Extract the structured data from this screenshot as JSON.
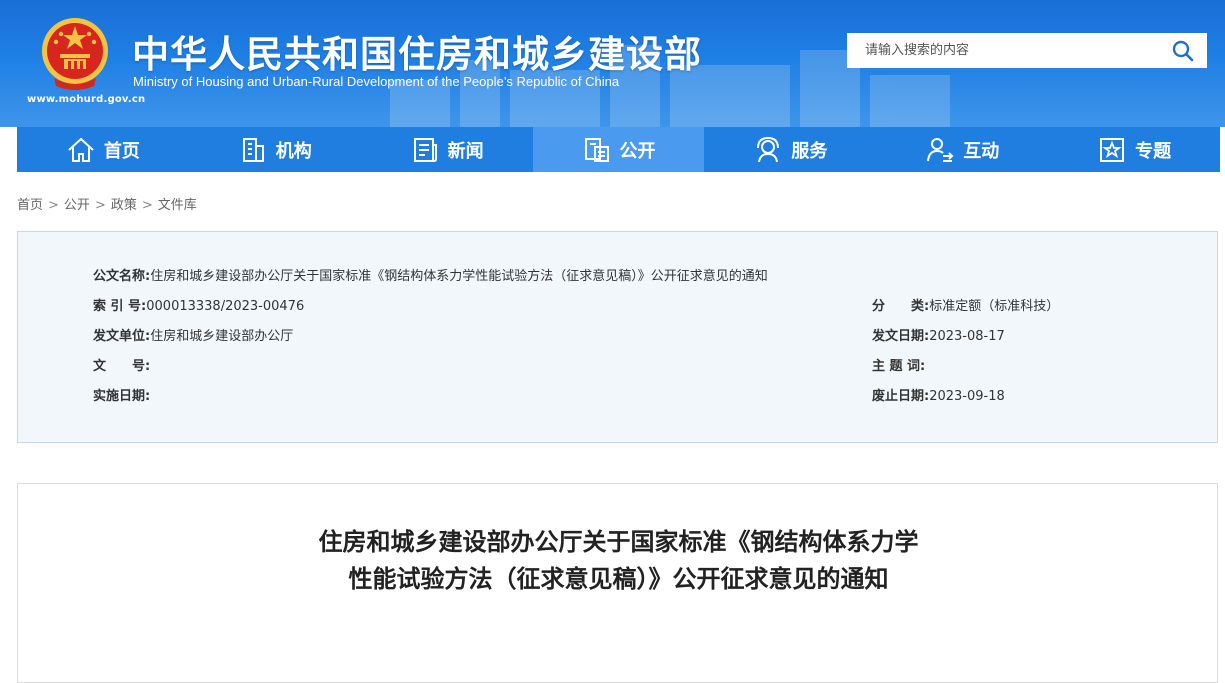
{
  "header": {
    "title": "中华人民共和国住房和城乡建设部",
    "subtitle": "Ministry of Housing and Urban-Rural Development of the People’s Republic of China",
    "url": "www.mohurd.gov.cn",
    "search_placeholder": "请输入搜索的内容",
    "colors": {
      "header_blue": "#1e7fe4",
      "nav_blue": "#1f7ee0",
      "nav_active": "#4a9bf0",
      "emblem_red": "#d7261e",
      "emblem_gold": "#f3c443"
    }
  },
  "nav": {
    "items": [
      {
        "label": "首页",
        "icon": "home-icon"
      },
      {
        "label": "机构",
        "icon": "building-icon"
      },
      {
        "label": "新闻",
        "icon": "news-icon"
      },
      {
        "label": "公开",
        "icon": "document-icon",
        "active": true
      },
      {
        "label": "服务",
        "icon": "service-icon"
      },
      {
        "label": "互动",
        "icon": "interaction-icon"
      },
      {
        "label": "专题",
        "icon": "star-icon"
      }
    ]
  },
  "breadcrumb": {
    "items": [
      "首页",
      "公开",
      "政策",
      "文件库"
    ],
    "separator": ">"
  },
  "info": {
    "doc_name_label": "公文名称:",
    "doc_name": "住房和城乡建设部办公厅关于国家标准《钢结构体系力学性能试验方法（征求意见稿）》公开征求意见的通知",
    "index_label": "索 引 号:",
    "index": "000013338/2023-00476",
    "category_label": "分　　类:",
    "category": "标准定额（标准科技）",
    "issuer_label": "发文单位:",
    "issuer": "住房和城乡建设部办公厅",
    "issue_date_label": "发文日期:",
    "issue_date": "2023-08-17",
    "doc_no_label": "文　　号:",
    "doc_no": "",
    "keywords_label": "主 题 词:",
    "keywords": "",
    "effective_label": "实施日期:",
    "effective": "",
    "expiry_label": "废止日期:",
    "expiry": "2023-09-18"
  },
  "article": {
    "title_line1": "住房和城乡建设部办公厅关于国家标准《钢结构体系力学",
    "title_line2": "性能试验方法（征求意见稿）》公开征求意见的通知"
  }
}
